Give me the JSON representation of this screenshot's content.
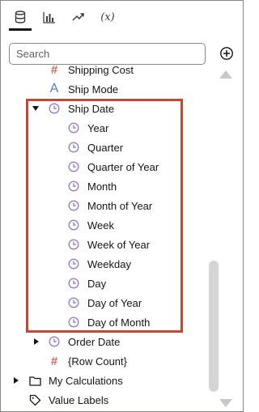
{
  "tabs": [
    {
      "name": "data-tab",
      "icon": "database-icon",
      "active": true
    },
    {
      "name": "visualizations-tab",
      "icon": "bar-chart-icon",
      "active": false
    },
    {
      "name": "analytics-tab",
      "icon": "trend-line-icon",
      "active": false
    },
    {
      "name": "calculations-tab",
      "icon": "function-icon",
      "label": "(x)",
      "active": false
    }
  ],
  "search": {
    "placeholder": "Search",
    "value": ""
  },
  "tree": {
    "shipping_cost": "Shipping Cost",
    "ship_mode": "Ship Mode",
    "ship_date": "Ship Date",
    "ship_date_children": [
      "Year",
      "Quarter",
      "Quarter of Year",
      "Month",
      "Month of Year",
      "Week",
      "Week of Year",
      "Weekday",
      "Day",
      "Day of Year",
      "Day of Month"
    ],
    "order_date": "Order Date",
    "row_count": "{Row Count}",
    "my_calculations": "My Calculations",
    "value_labels": "Value Labels"
  },
  "colors": {
    "highlight": "#c74634",
    "measure": "#d2695a",
    "attribute": "#4f7fb8",
    "time": "#9b7fc4"
  }
}
